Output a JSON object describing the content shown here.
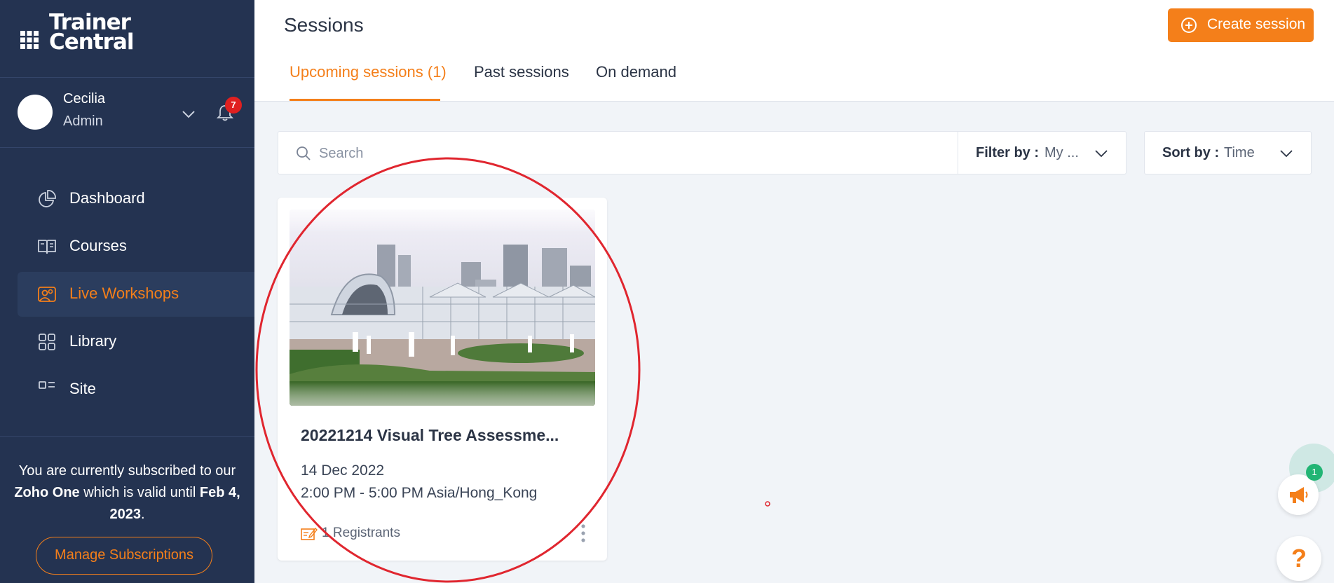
{
  "brand": {
    "logo_line1": "Trainer",
    "logo_line2": "Central"
  },
  "user": {
    "name": "Cecilia",
    "role": "Admin",
    "notification_count": "7"
  },
  "sidebar": {
    "items": [
      {
        "label": "Dashboard",
        "icon": "pie-chart-icon",
        "active": false
      },
      {
        "label": "Courses",
        "icon": "book-icon",
        "active": false
      },
      {
        "label": "Live Workshops",
        "icon": "users-icon",
        "active": true
      },
      {
        "label": "Library",
        "icon": "grid-icon",
        "active": false
      },
      {
        "label": "Site",
        "icon": "site-icon",
        "active": false
      }
    ],
    "subscription": {
      "prefix": "You are currently subscribed to our ",
      "plan": "Zoho One",
      "middle": " which is valid until ",
      "until": "Feb 4, 2023",
      "suffix": "."
    },
    "manage_label": "Manage Subscriptions"
  },
  "header": {
    "title": "Sessions",
    "create_label": "Create session",
    "tabs": [
      {
        "label": "Upcoming sessions (1)",
        "active": true
      },
      {
        "label": "Past sessions",
        "active": false
      },
      {
        "label": "On demand",
        "active": false
      }
    ]
  },
  "toolbar": {
    "search_placeholder": "Search",
    "filter_label": "Filter by :",
    "filter_value": "My ...",
    "sort_label": "Sort by :",
    "sort_value": "Time"
  },
  "sessions": [
    {
      "title": "20221214 Visual Tree Assessme...",
      "date": "14 Dec 2022",
      "time": "2:00 PM - 5:00 PM Asia/Hong_Kong",
      "registrants": "1 Registrants"
    }
  ],
  "widgets": {
    "announce_count": "1",
    "help_label": "?"
  },
  "colors": {
    "sidebar_bg": "#243351",
    "accent": "#f47f1a",
    "badge_red": "#e02020",
    "badge_green": "#22b574",
    "annotation_red": "#e0262f"
  }
}
